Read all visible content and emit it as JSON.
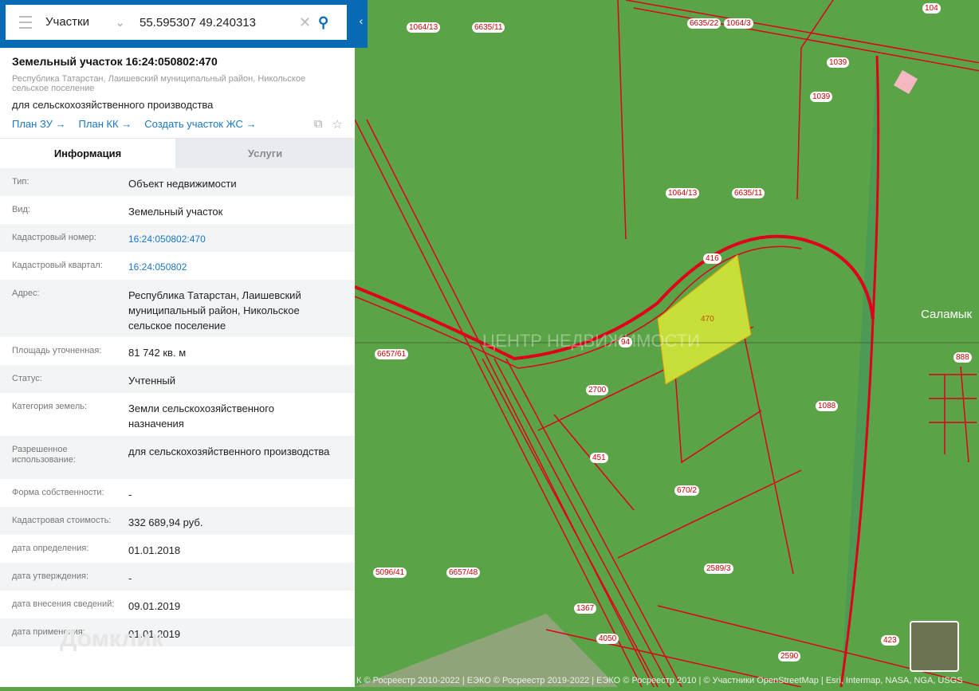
{
  "search": {
    "category": "Участки",
    "query": "55.595307 49.240313"
  },
  "object": {
    "title": "Земельный участок 16:24:050802:470",
    "address": "Республика Татарстан, Лаишевский муниципальный район, Никольское сельское поселение",
    "use": "для сельскохозяйственного производства",
    "links": [
      "План ЗУ →",
      "План КК →",
      "Создать участок ЖС →"
    ]
  },
  "tabs": [
    "Информация",
    "Услуги"
  ],
  "rows": [
    {
      "k": "Тип:",
      "v": "Объект недвижимости"
    },
    {
      "k": "Вид:",
      "v": "Земельный участок"
    },
    {
      "k": "Кадастровый номер:",
      "v": "16:24:050802:470",
      "link": true
    },
    {
      "k": "Кадастровый квартал:",
      "v": "16:24:050802",
      "link": true
    },
    {
      "k": "Адрес:",
      "v": "Республика Татарстан, Лаишевский муниципальный район, Никольское сельское поселение"
    },
    {
      "k": "Площадь уточненная:",
      "v": "81 742 кв. м"
    },
    {
      "k": "Статус:",
      "v": "Учтенный"
    },
    {
      "k": "Категория земель:",
      "v": "Земли сельскохозяйственного назначения"
    },
    {
      "k": "Разрешенное использование:",
      "v": "для сельскохозяйственного производства"
    },
    {
      "k": "Форма собственности:",
      "v": "-"
    },
    {
      "k": "Кадастровая стоимость:",
      "v": "332 689,94 руб."
    },
    {
      "k": "дата определения:",
      "v": "01.01.2018"
    },
    {
      "k": "дата утверждения:",
      "v": "-"
    },
    {
      "k": "дата внесения сведений:",
      "v": "09.01.2019"
    },
    {
      "k": "дата применения:",
      "v": "01.01.2019"
    }
  ],
  "watermark": "Домклик",
  "map": {
    "town": "Саламык",
    "watermark": "ЦЕНТР НЕДВИЖИМОСТИ",
    "labels": [
      [
        "1064/13",
        510,
        28
      ],
      [
        "6635/11",
        592,
        28
      ],
      [
        "6635/22",
        862,
        23
      ],
      [
        "1064/3",
        908,
        23
      ],
      [
        "104",
        1157,
        4
      ],
      [
        "1039",
        1037,
        72
      ],
      [
        "1039",
        1016,
        115
      ],
      [
        "1064/13",
        835,
        236
      ],
      [
        "6635/11",
        918,
        236
      ],
      [
        "416",
        882,
        318
      ],
      [
        "470",
        876,
        394
      ],
      [
        "94",
        776,
        423
      ],
      [
        "888",
        1196,
        442
      ],
      [
        "6657/61",
        470,
        438
      ],
      [
        "2700",
        735,
        483
      ],
      [
        "1088",
        1023,
        503
      ],
      [
        "451",
        740,
        568
      ],
      [
        "670/2",
        846,
        609
      ],
      [
        "2589/3",
        883,
        707
      ],
      [
        "5096/41",
        468,
        712
      ],
      [
        "6657/48",
        560,
        712
      ],
      [
        "1367",
        720,
        757
      ],
      [
        "4050",
        748,
        795
      ],
      [
        "2590",
        976,
        817
      ],
      [
        "423",
        1105,
        797
      ]
    ],
    "attribution": "К © Росреестр 2010-2022 | ЕЭКО © Росреестр 2019-2022 | ЕЭКО © Росреестр 2010 | © Участники OpenStreetMap | Esri, Intermap, NASA, NGA, USGS"
  },
  "colors": {
    "accent": "#0a6bb5",
    "boundary": "#e0001a",
    "parcel": "#c8df3a"
  }
}
